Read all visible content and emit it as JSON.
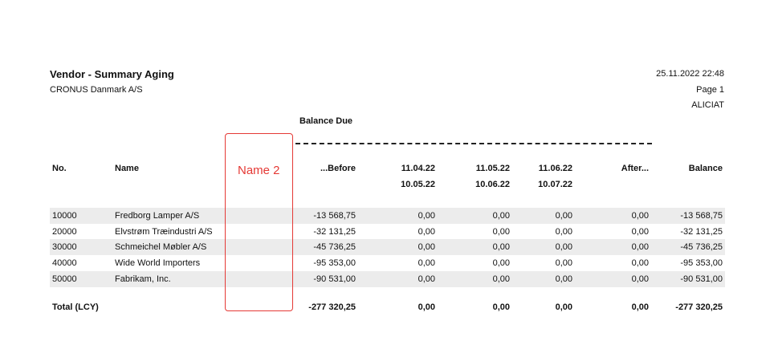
{
  "report": {
    "title": "Vendor - Summary Aging",
    "company": "CRONUS Danmark A/S",
    "datetime": "25.11.2022 22:48",
    "page": "Page 1",
    "user": "ALICIAT",
    "balance_due_label": "Balance Due"
  },
  "headers": {
    "no": "No.",
    "name": "Name",
    "before": "...Before",
    "p1_from": "11.04.22",
    "p1_to": "10.05.22",
    "p2_from": "11.05.22",
    "p2_to": "10.06.22",
    "p3_from": "11.06.22",
    "p3_to": "10.07.22",
    "after": "After...",
    "balance": "Balance"
  },
  "rows": [
    {
      "no": "10000",
      "name": "Fredborg Lamper A/S",
      "before": "-13 568,75",
      "p1": "0,00",
      "p2": "0,00",
      "p3": "0,00",
      "after": "0,00",
      "balance": "-13 568,75"
    },
    {
      "no": "20000",
      "name": "Elvstrøm Træindustri A/S",
      "before": "-32 131,25",
      "p1": "0,00",
      "p2": "0,00",
      "p3": "0,00",
      "after": "0,00",
      "balance": "-32 131,25"
    },
    {
      "no": "30000",
      "name": "Schmeichel Møbler A/S",
      "before": "-45 736,25",
      "p1": "0,00",
      "p2": "0,00",
      "p3": "0,00",
      "after": "0,00",
      "balance": "-45 736,25"
    },
    {
      "no": "40000",
      "name": "Wide World Importers",
      "before": "-95 353,00",
      "p1": "0,00",
      "p2": "0,00",
      "p3": "0,00",
      "after": "0,00",
      "balance": "-95 353,00"
    },
    {
      "no": "50000",
      "name": "Fabrikam, Inc.",
      "before": "-90 531,00",
      "p1": "0,00",
      "p2": "0,00",
      "p3": "0,00",
      "after": "0,00",
      "balance": "-90 531,00"
    }
  ],
  "total": {
    "label": "Total (LCY)",
    "before": "-277 320,25",
    "p1": "0,00",
    "p2": "0,00",
    "p3": "0,00",
    "after": "0,00",
    "balance": "-277 320,25"
  },
  "annotation": {
    "label": "Name 2",
    "color": "#e53935"
  }
}
